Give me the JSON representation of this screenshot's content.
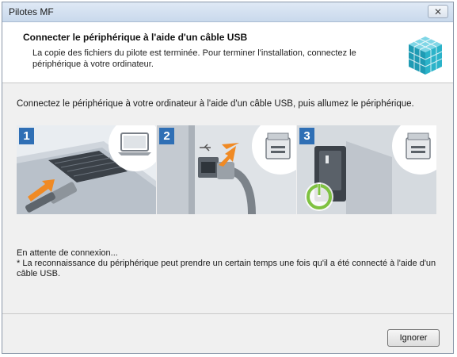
{
  "window": {
    "title": "Pilotes MF",
    "close_label": "✕"
  },
  "header": {
    "title": "Connecter le périphérique à l'aide d'un câble USB",
    "description": "La copie des fichiers du pilote est terminée. Pour terminer l'installation, connectez le périphérique à votre ordinateur.",
    "icon": "installer-cubes-icon"
  },
  "content": {
    "instruction": "Connectez le périphérique à votre ordinateur à l'aide d'un câble USB, puis allumez le périphérique.",
    "steps": [
      {
        "number": "1",
        "icon": "laptop-usb-port-illustration"
      },
      {
        "number": "2",
        "icon": "usb-cable-plug-illustration"
      },
      {
        "number": "3",
        "icon": "power-button-illustration"
      }
    ],
    "status": "En attente de connexion...",
    "note": "* La reconnaissance du périphérique peut prendre un certain temps une fois qu'il a été connecté à l'aide d'un câble USB."
  },
  "footer": {
    "ignore_label": "Ignorer"
  },
  "colors": {
    "step_number_bg": "#2f6fb5",
    "accent_orange": "#f08a24",
    "power_green": "#7fc241"
  }
}
